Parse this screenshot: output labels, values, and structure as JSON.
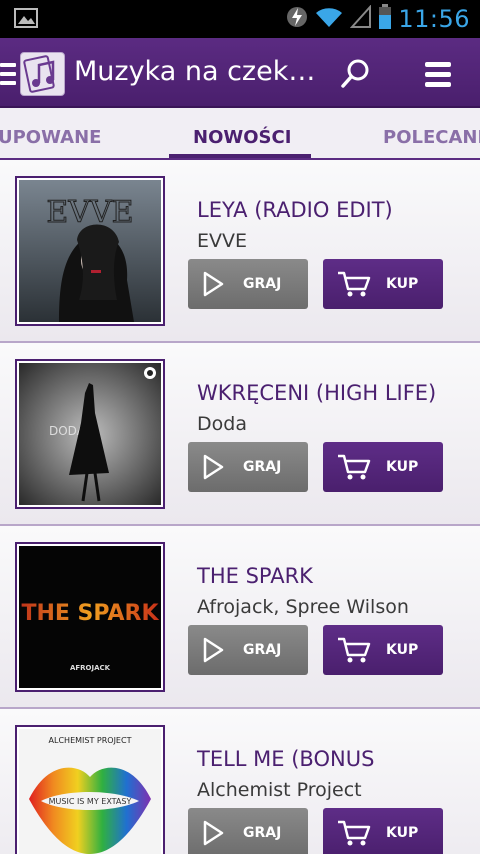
{
  "status": {
    "time": "11:56"
  },
  "actionbar": {
    "title": "Muzyka na czek…"
  },
  "tabs": [
    {
      "label": "UPOWANE"
    },
    {
      "label": "NOWOŚCI"
    },
    {
      "label": "POLECANE"
    }
  ],
  "tracks": [
    {
      "title": "LEYA (RADIO EDIT)",
      "artist": "EVVE",
      "play_label": "GRAJ",
      "buy_label": "KUP",
      "cover_text": "EVVE"
    },
    {
      "title": "WKRĘCENI (HIGH LIFE)",
      "artist": "Doda",
      "play_label": "GRAJ",
      "buy_label": "KUP",
      "cover_text": "DODA"
    },
    {
      "title": "THE SPARK",
      "artist": "Afrojack, Spree Wilson",
      "play_label": "GRAJ",
      "buy_label": "KUP",
      "cover_text": "THE SPARK",
      "cover_subtext": "AFROJACK"
    },
    {
      "title": "TELL ME (BONUS",
      "artist": "Alchemist Project",
      "play_label": "GRAJ",
      "buy_label": "KUP",
      "cover_text": "ALCHEMIST PROJECT",
      "cover_subtext": "MUSIC IS MY EXTASY"
    }
  ],
  "colors": {
    "accent": "#4b2070",
    "play_button": "#7a7a7a",
    "statusbar_text": "#3aa6e8"
  }
}
